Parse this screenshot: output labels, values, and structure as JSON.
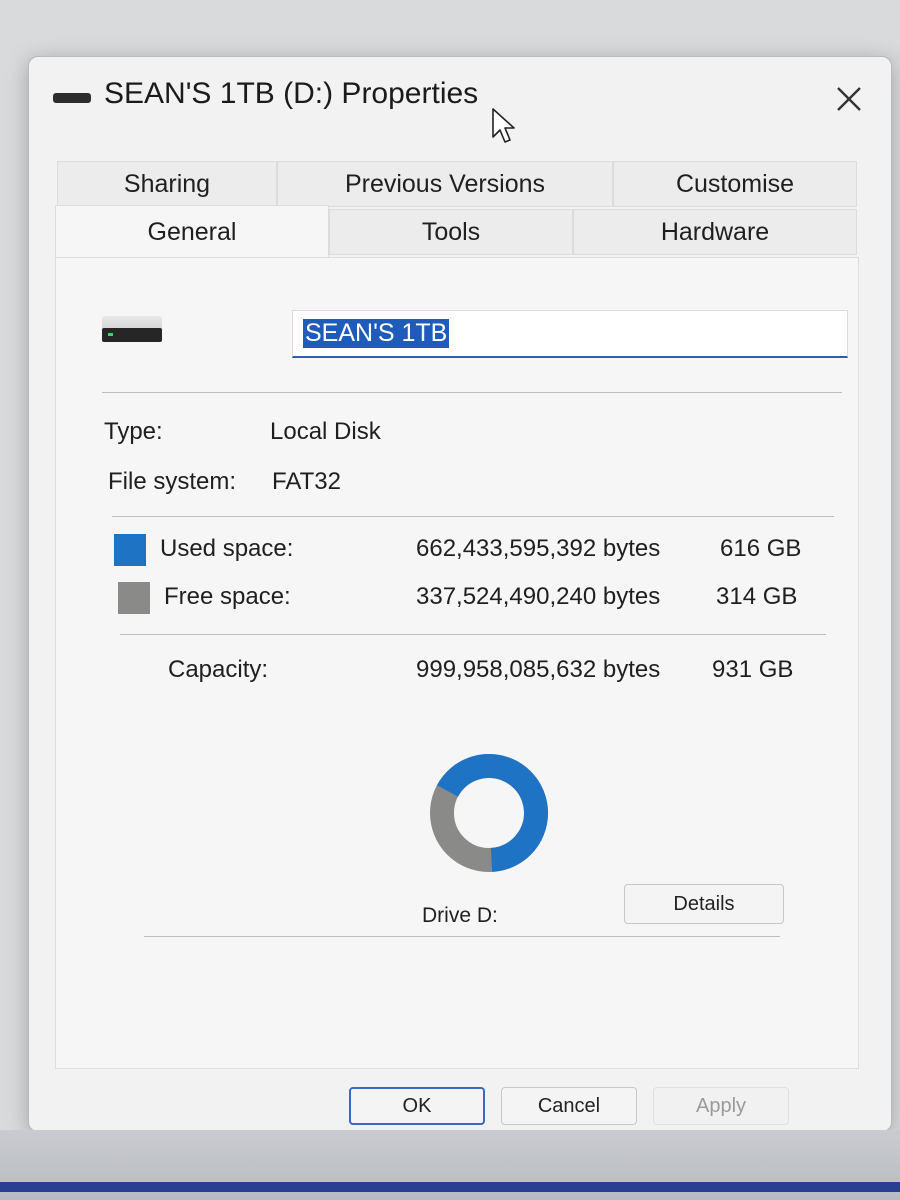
{
  "window": {
    "title": "SEAN'S 1TB (D:) Properties"
  },
  "tabs": {
    "row1": [
      "Sharing",
      "Previous Versions",
      "Customise"
    ],
    "row2": [
      "General",
      "Tools",
      "Hardware"
    ],
    "active": "General"
  },
  "general": {
    "name_value": "SEAN'S 1TB",
    "type_label": "Type:",
    "type_value": "Local Disk",
    "fs_label": "File system:",
    "fs_value": "FAT32",
    "used": {
      "label": "Used space:",
      "bytes": "662,433,595,392 bytes",
      "size": "616 GB",
      "color": "#1e73c4"
    },
    "free": {
      "label": "Free space:",
      "bytes": "337,524,490,240 bytes",
      "size": "314 GB",
      "color": "#8a8a88"
    },
    "capacity": {
      "label": "Capacity:",
      "bytes": "999,958,085,632 bytes",
      "size": "931 GB"
    },
    "drive_label": "Drive D:",
    "used_fraction": 0.6625
  },
  "buttons": {
    "details": "Details",
    "ok": "OK",
    "cancel": "Cancel",
    "apply": "Apply"
  }
}
